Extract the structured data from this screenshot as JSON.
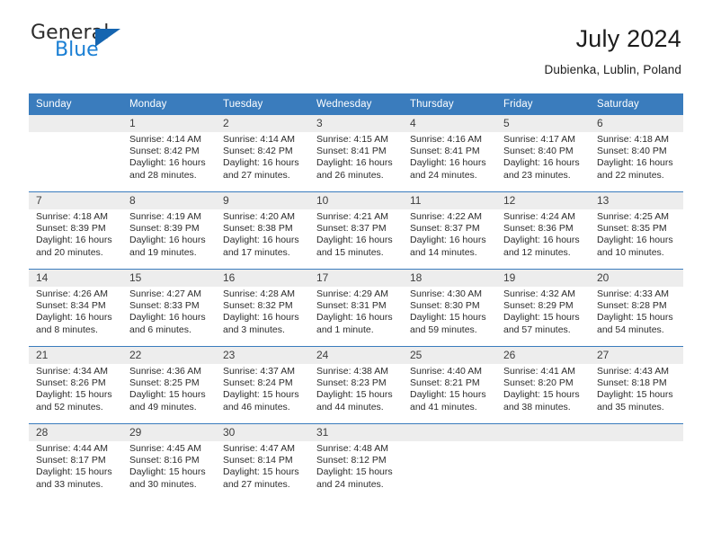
{
  "brand": {
    "name_part1": "General",
    "name_part2": "Blue",
    "triangle_color": "#1565b0",
    "blue_color": "#1a7fd4"
  },
  "header": {
    "title": "July 2024",
    "location": "Dubienka, Lublin, Poland"
  },
  "theme": {
    "header_bg": "#3a7cbd",
    "header_text": "#ffffff",
    "daynum_bg": "#ededed",
    "grid_line": "#3a7cbd"
  },
  "weekdays": [
    "Sunday",
    "Monday",
    "Tuesday",
    "Wednesday",
    "Thursday",
    "Friday",
    "Saturday"
  ],
  "weeks": [
    [
      {
        "day": "",
        "empty": true
      },
      {
        "day": "1",
        "sunrise": "Sunrise: 4:14 AM",
        "sunset": "Sunset: 8:42 PM",
        "daylight1": "Daylight: 16 hours",
        "daylight2": "and 28 minutes."
      },
      {
        "day": "2",
        "sunrise": "Sunrise: 4:14 AM",
        "sunset": "Sunset: 8:42 PM",
        "daylight1": "Daylight: 16 hours",
        "daylight2": "and 27 minutes."
      },
      {
        "day": "3",
        "sunrise": "Sunrise: 4:15 AM",
        "sunset": "Sunset: 8:41 PM",
        "daylight1": "Daylight: 16 hours",
        "daylight2": "and 26 minutes."
      },
      {
        "day": "4",
        "sunrise": "Sunrise: 4:16 AM",
        "sunset": "Sunset: 8:41 PM",
        "daylight1": "Daylight: 16 hours",
        "daylight2": "and 24 minutes."
      },
      {
        "day": "5",
        "sunrise": "Sunrise: 4:17 AM",
        "sunset": "Sunset: 8:40 PM",
        "daylight1": "Daylight: 16 hours",
        "daylight2": "and 23 minutes."
      },
      {
        "day": "6",
        "sunrise": "Sunrise: 4:18 AM",
        "sunset": "Sunset: 8:40 PM",
        "daylight1": "Daylight: 16 hours",
        "daylight2": "and 22 minutes."
      }
    ],
    [
      {
        "day": "7",
        "sunrise": "Sunrise: 4:18 AM",
        "sunset": "Sunset: 8:39 PM",
        "daylight1": "Daylight: 16 hours",
        "daylight2": "and 20 minutes."
      },
      {
        "day": "8",
        "sunrise": "Sunrise: 4:19 AM",
        "sunset": "Sunset: 8:39 PM",
        "daylight1": "Daylight: 16 hours",
        "daylight2": "and 19 minutes."
      },
      {
        "day": "9",
        "sunrise": "Sunrise: 4:20 AM",
        "sunset": "Sunset: 8:38 PM",
        "daylight1": "Daylight: 16 hours",
        "daylight2": "and 17 minutes."
      },
      {
        "day": "10",
        "sunrise": "Sunrise: 4:21 AM",
        "sunset": "Sunset: 8:37 PM",
        "daylight1": "Daylight: 16 hours",
        "daylight2": "and 15 minutes."
      },
      {
        "day": "11",
        "sunrise": "Sunrise: 4:22 AM",
        "sunset": "Sunset: 8:37 PM",
        "daylight1": "Daylight: 16 hours",
        "daylight2": "and 14 minutes."
      },
      {
        "day": "12",
        "sunrise": "Sunrise: 4:24 AM",
        "sunset": "Sunset: 8:36 PM",
        "daylight1": "Daylight: 16 hours",
        "daylight2": "and 12 minutes."
      },
      {
        "day": "13",
        "sunrise": "Sunrise: 4:25 AM",
        "sunset": "Sunset: 8:35 PM",
        "daylight1": "Daylight: 16 hours",
        "daylight2": "and 10 minutes."
      }
    ],
    [
      {
        "day": "14",
        "sunrise": "Sunrise: 4:26 AM",
        "sunset": "Sunset: 8:34 PM",
        "daylight1": "Daylight: 16 hours",
        "daylight2": "and 8 minutes."
      },
      {
        "day": "15",
        "sunrise": "Sunrise: 4:27 AM",
        "sunset": "Sunset: 8:33 PM",
        "daylight1": "Daylight: 16 hours",
        "daylight2": "and 6 minutes."
      },
      {
        "day": "16",
        "sunrise": "Sunrise: 4:28 AM",
        "sunset": "Sunset: 8:32 PM",
        "daylight1": "Daylight: 16 hours",
        "daylight2": "and 3 minutes."
      },
      {
        "day": "17",
        "sunrise": "Sunrise: 4:29 AM",
        "sunset": "Sunset: 8:31 PM",
        "daylight1": "Daylight: 16 hours",
        "daylight2": "and 1 minute."
      },
      {
        "day": "18",
        "sunrise": "Sunrise: 4:30 AM",
        "sunset": "Sunset: 8:30 PM",
        "daylight1": "Daylight: 15 hours",
        "daylight2": "and 59 minutes."
      },
      {
        "day": "19",
        "sunrise": "Sunrise: 4:32 AM",
        "sunset": "Sunset: 8:29 PM",
        "daylight1": "Daylight: 15 hours",
        "daylight2": "and 57 minutes."
      },
      {
        "day": "20",
        "sunrise": "Sunrise: 4:33 AM",
        "sunset": "Sunset: 8:28 PM",
        "daylight1": "Daylight: 15 hours",
        "daylight2": "and 54 minutes."
      }
    ],
    [
      {
        "day": "21",
        "sunrise": "Sunrise: 4:34 AM",
        "sunset": "Sunset: 8:26 PM",
        "daylight1": "Daylight: 15 hours",
        "daylight2": "and 52 minutes."
      },
      {
        "day": "22",
        "sunrise": "Sunrise: 4:36 AM",
        "sunset": "Sunset: 8:25 PM",
        "daylight1": "Daylight: 15 hours",
        "daylight2": "and 49 minutes."
      },
      {
        "day": "23",
        "sunrise": "Sunrise: 4:37 AM",
        "sunset": "Sunset: 8:24 PM",
        "daylight1": "Daylight: 15 hours",
        "daylight2": "and 46 minutes."
      },
      {
        "day": "24",
        "sunrise": "Sunrise: 4:38 AM",
        "sunset": "Sunset: 8:23 PM",
        "daylight1": "Daylight: 15 hours",
        "daylight2": "and 44 minutes."
      },
      {
        "day": "25",
        "sunrise": "Sunrise: 4:40 AM",
        "sunset": "Sunset: 8:21 PM",
        "daylight1": "Daylight: 15 hours",
        "daylight2": "and 41 minutes."
      },
      {
        "day": "26",
        "sunrise": "Sunrise: 4:41 AM",
        "sunset": "Sunset: 8:20 PM",
        "daylight1": "Daylight: 15 hours",
        "daylight2": "and 38 minutes."
      },
      {
        "day": "27",
        "sunrise": "Sunrise: 4:43 AM",
        "sunset": "Sunset: 8:18 PM",
        "daylight1": "Daylight: 15 hours",
        "daylight2": "and 35 minutes."
      }
    ],
    [
      {
        "day": "28",
        "sunrise": "Sunrise: 4:44 AM",
        "sunset": "Sunset: 8:17 PM",
        "daylight1": "Daylight: 15 hours",
        "daylight2": "and 33 minutes."
      },
      {
        "day": "29",
        "sunrise": "Sunrise: 4:45 AM",
        "sunset": "Sunset: 8:16 PM",
        "daylight1": "Daylight: 15 hours",
        "daylight2": "and 30 minutes."
      },
      {
        "day": "30",
        "sunrise": "Sunrise: 4:47 AM",
        "sunset": "Sunset: 8:14 PM",
        "daylight1": "Daylight: 15 hours",
        "daylight2": "and 27 minutes."
      },
      {
        "day": "31",
        "sunrise": "Sunrise: 4:48 AM",
        "sunset": "Sunset: 8:12 PM",
        "daylight1": "Daylight: 15 hours",
        "daylight2": "and 24 minutes."
      },
      {
        "day": "",
        "empty": true
      },
      {
        "day": "",
        "empty": true
      },
      {
        "day": "",
        "empty": true
      }
    ]
  ]
}
